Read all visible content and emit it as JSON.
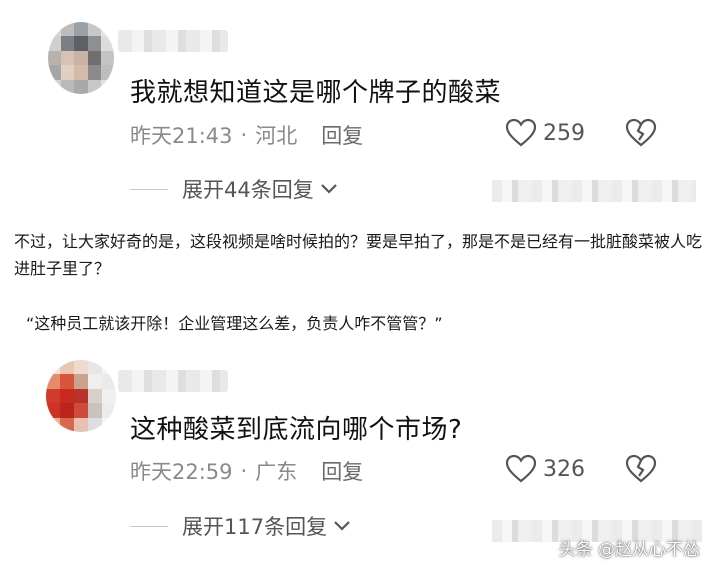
{
  "comments": [
    {
      "text": "我就想知道这是哪个牌子的酸菜",
      "time": "昨天21:43",
      "sep": "·",
      "location": "河北",
      "reply_label": "回复",
      "likes": "259",
      "expand_label": "展开44条回复"
    },
    {
      "text": "这种酸菜到底流向哪个市场?",
      "time": "昨天22:59",
      "sep": "·",
      "location": "广东",
      "reply_label": "回复",
      "likes": "326",
      "expand_label": "展开117条回复"
    }
  ],
  "article": {
    "paragraph1": "不过，让大家好奇的是，这段视频是啥时候拍的？要是早拍了，那是不是已经有一批脏酸菜被人吃进肚子里了？",
    "paragraph2": "“这种员工就该开除！企业管理这么差，负责人咋不管管？”"
  },
  "watermark": "头条 @赵从心不怂",
  "icons": {
    "like": "heart-outline-icon",
    "dislike": "broken-heart-icon",
    "expand": "chevron-down-icon"
  },
  "colors": {
    "meta_gray": "#8a8a8a",
    "text": "#111111"
  }
}
